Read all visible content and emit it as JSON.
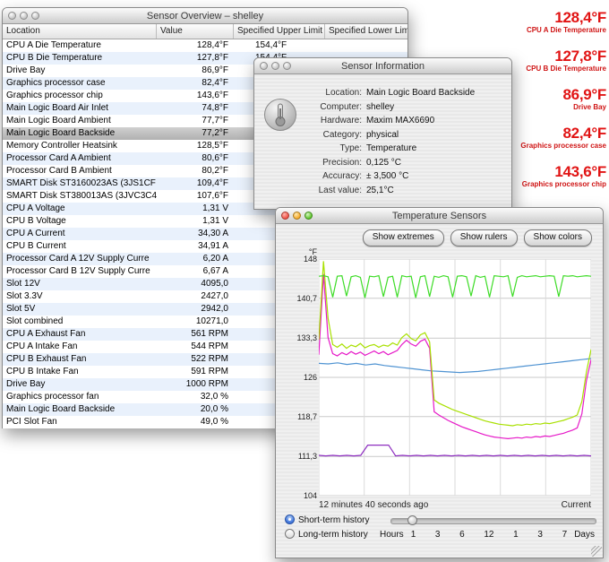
{
  "overview_window": {
    "title": "Sensor Overview – shelley",
    "columns": [
      "Location",
      "Value",
      "Specified Upper Limit",
      "Specified Lower Limit"
    ],
    "rows": [
      {
        "location": "CPU A Die Temperature",
        "value": "128,4°F",
        "upper": "154,4°F",
        "lower": ""
      },
      {
        "location": "CPU B Die Temperature",
        "value": "127,8°F",
        "upper": "154,4°F",
        "lower": ""
      },
      {
        "location": "Drive Bay",
        "value": "86,9°F",
        "upper": "",
        "lower": ""
      },
      {
        "location": "Graphics processor case",
        "value": "82,4°F",
        "upper": "",
        "lower": ""
      },
      {
        "location": "Graphics processor chip",
        "value": "143,6°F",
        "upper": "",
        "lower": ""
      },
      {
        "location": "Main Logic Board Air Inlet",
        "value": "74,8°F",
        "upper": "",
        "lower": ""
      },
      {
        "location": "Main Logic Board Ambient",
        "value": "77,7°F",
        "upper": "",
        "lower": ""
      },
      {
        "location": "Main Logic Board Backside",
        "value": "77,2°F",
        "upper": "",
        "lower": "",
        "selected": true
      },
      {
        "location": "Memory Controller Heatsink",
        "value": "128,5°F",
        "upper": "",
        "lower": ""
      },
      {
        "location": "Processor Card A Ambient",
        "value": "80,6°F",
        "upper": "",
        "lower": ""
      },
      {
        "location": "Processor Card B Ambient",
        "value": "80,2°F",
        "upper": "",
        "lower": ""
      },
      {
        "location": "SMART Disk ST3160023AS (3JS1CF",
        "value": "109,4°F",
        "upper": "",
        "lower": ""
      },
      {
        "location": "SMART Disk ST380013AS (3JVC3C4",
        "value": "107,6°F",
        "upper": "",
        "lower": ""
      },
      {
        "location": "CPU A Voltage",
        "value": "1,31 V",
        "upper": "",
        "lower": ""
      },
      {
        "location": "CPU B Voltage",
        "value": "1,31 V",
        "upper": "",
        "lower": ""
      },
      {
        "location": "CPU A Current",
        "value": "34,30 A",
        "upper": "",
        "lower": ""
      },
      {
        "location": "CPU B Current",
        "value": "34,91 A",
        "upper": "",
        "lower": ""
      },
      {
        "location": "Processor Card A 12V Supply Curre",
        "value": "6,20 A",
        "upper": "",
        "lower": ""
      },
      {
        "location": "Processor Card B 12V Supply Curre",
        "value": "6,67 A",
        "upper": "",
        "lower": ""
      },
      {
        "location": "Slot 12V",
        "value": "4095,0",
        "upper": "",
        "lower": ""
      },
      {
        "location": "Slot 3.3V",
        "value": "2427,0",
        "upper": "",
        "lower": ""
      },
      {
        "location": "Slot 5V",
        "value": "2942,0",
        "upper": "",
        "lower": ""
      },
      {
        "location": "Slot combined",
        "value": "10271,0",
        "upper": "",
        "lower": ""
      },
      {
        "location": "CPU A Exhaust Fan",
        "value": "561 RPM",
        "upper": "",
        "lower": ""
      },
      {
        "location": "CPU A Intake Fan",
        "value": "544 RPM",
        "upper": "",
        "lower": ""
      },
      {
        "location": "CPU B Exhaust Fan",
        "value": "522 RPM",
        "upper": "",
        "lower": ""
      },
      {
        "location": "CPU B Intake Fan",
        "value": "591 RPM",
        "upper": "",
        "lower": ""
      },
      {
        "location": "Drive Bay",
        "value": "1000 RPM",
        "upper": "",
        "lower": ""
      },
      {
        "location": "Graphics processor fan",
        "value": "32,0 %",
        "upper": "",
        "lower": ""
      },
      {
        "location": "Main Logic Board Backside",
        "value": "20,0 %",
        "upper": "",
        "lower": ""
      },
      {
        "location": "PCI Slot Fan",
        "value": "49,0 %",
        "upper": "",
        "lower": ""
      }
    ]
  },
  "info_window": {
    "title": "Sensor Information",
    "fields": [
      {
        "label": "Location:",
        "value": "Main Logic Board Backside"
      },
      {
        "label": "Computer:",
        "value": "shelley"
      },
      {
        "label": "Hardware:",
        "value": "Maxim MAX6690"
      },
      {
        "label": "Category:",
        "value": "physical"
      },
      {
        "label": "Type:",
        "value": "Temperature"
      },
      {
        "label": "Precision:",
        "value": "0,125 °C"
      },
      {
        "label": "Accuracy:",
        "value": "± 3,500 °C"
      },
      {
        "label": "Last value:",
        "value": "25,1°C"
      }
    ]
  },
  "chart_window": {
    "title": "Temperature Sensors",
    "buttons": [
      "Show extremes",
      "Show rulers",
      "Show colors"
    ],
    "footer_left": "12 minutes 40 seconds ago",
    "footer_right": "Current",
    "history": {
      "short_label": "Short-term history",
      "long_label": "Long-term history",
      "selected": "short",
      "slider_pos": 0.1,
      "hours_prefix": "Hours",
      "hours_ticks": [
        "1",
        "3",
        "6",
        "12",
        "1",
        "3",
        "7"
      ],
      "hours_suffix": "Days"
    }
  },
  "chart_data": {
    "type": "line",
    "title": "Temperature Sensors",
    "ylabel": "°F",
    "ylim": [
      104,
      148
    ],
    "xlim": [
      0,
      1
    ],
    "grid": true,
    "x_range_labels": [
      "12 minutes 40 seconds ago",
      "Current"
    ],
    "yticks": [
      {
        "label": "148",
        "value": 148
      },
      {
        "label": "140,7",
        "value": 140.7
      },
      {
        "label": "133,3",
        "value": 133.3
      },
      {
        "label": "126",
        "value": 126
      },
      {
        "label": "118,7",
        "value": 118.7
      },
      {
        "label": "111,3",
        "value": 111.3
      },
      {
        "label": "104",
        "value": 104
      }
    ],
    "series": [
      {
        "name": "purple",
        "color": "#8e2fc0",
        "values": [
          111.5,
          111.4,
          111.5,
          111.4,
          111.5,
          111.4,
          111.5,
          113.4,
          113.4,
          113.4,
          113.4,
          111.4,
          111.5,
          111.4,
          111.5,
          111.4,
          111.5,
          111.4,
          111.5,
          111.4,
          111.5,
          111.4,
          111.5,
          111.4,
          111.5,
          111.4,
          111.5,
          111.4,
          111.5,
          111.4,
          111.5,
          111.4,
          111.5,
          111.4,
          111.5,
          111.4,
          111.5,
          111.4,
          111.5,
          111.4
        ]
      },
      {
        "name": "blue",
        "color": "#4f93d2",
        "values": [
          128.6,
          128.5,
          128.7,
          128.4,
          128.6,
          128.3,
          128.5,
          128.2,
          128.0,
          127.8,
          127.6,
          127.4,
          127.2,
          127.1,
          127.0,
          126.9,
          127.0,
          127.1,
          127.3,
          127.5,
          127.7,
          127.9,
          128.1,
          128.3,
          128.5,
          128.7,
          128.9,
          129.1,
          129.3,
          129.5
        ]
      },
      {
        "name": "magenta",
        "color": "#e619c8",
        "values": [
          130.2,
          145.2,
          133.4,
          130.4,
          130.0,
          130.6,
          130.2,
          130.8,
          130.3,
          130.7,
          130.1,
          130.5,
          130.9,
          130.4,
          130.8,
          130.2,
          130.6,
          131.0,
          132.1,
          132.9,
          132.2,
          131.8,
          132.7,
          133.1,
          131.4,
          119.6,
          119.0,
          118.5,
          118.0,
          117.6,
          117.2,
          116.8,
          116.5,
          116.2,
          115.9,
          115.6,
          115.3,
          115.1,
          114.9,
          114.8,
          114.7,
          114.6,
          114.7,
          114.8,
          114.7,
          114.9,
          114.8,
          115.0,
          114.9,
          115.1,
          115.0,
          115.2,
          115.4,
          115.6,
          115.9,
          116.2,
          116.6,
          119.2,
          125.4,
          129.3
        ]
      },
      {
        "name": "yellow-green",
        "color": "#a8e000",
        "values": [
          133.0,
          147.6,
          137.0,
          132.1,
          131.6,
          132.2,
          131.4,
          132.0,
          131.7,
          132.3,
          131.5,
          131.9,
          132.1,
          131.6,
          132.0,
          131.8,
          132.4,
          132.0,
          133.4,
          134.1,
          133.2,
          132.8,
          133.9,
          134.3,
          132.6,
          121.8,
          121.2,
          120.8,
          120.4,
          120.0,
          119.7,
          119.4,
          119.1,
          118.8,
          118.5,
          118.2,
          117.9,
          117.7,
          117.5,
          117.3,
          117.2,
          117.1,
          117.0,
          117.2,
          117.1,
          117.3,
          117.2,
          117.4,
          117.3,
          117.5,
          117.4,
          117.6,
          117.8,
          118.0,
          118.3,
          118.6,
          119.0,
          121.5,
          127.0,
          131.2
        ]
      },
      {
        "name": "green",
        "color": "#3ddc26",
        "values": [
          144.8,
          144.9,
          144.7,
          140.9,
          144.8,
          144.9,
          141.1,
          144.7,
          144.9,
          144.6,
          140.8,
          144.8,
          144.7,
          144.9,
          141.0,
          144.6,
          144.8,
          140.9,
          144.9,
          144.7,
          144.8,
          140.8,
          144.7,
          144.9,
          141.0,
          144.8,
          144.6,
          144.9,
          144.7,
          140.9,
          144.8,
          144.9,
          144.7,
          141.1,
          144.9,
          144.6,
          144.8,
          140.9,
          144.9,
          144.8,
          144.7,
          144.9,
          141.0,
          144.6,
          144.9,
          144.7,
          144.8,
          144.9,
          144.7,
          144.8,
          144.9,
          144.8,
          141.0,
          144.9,
          144.8,
          144.9,
          144.7,
          144.8,
          144.9,
          144.8
        ]
      }
    ]
  },
  "readouts": [
    {
      "value": "128,4°F",
      "label": "CPU A Die Temperature"
    },
    {
      "value": "127,8°F",
      "label": "CPU B Die Temperature"
    },
    {
      "value": "86,9°F",
      "label": "Drive Bay"
    },
    {
      "value": "82,4°F",
      "label": "Graphics processor case"
    },
    {
      "value": "143,6°F",
      "label": "Graphics processor chip"
    }
  ]
}
